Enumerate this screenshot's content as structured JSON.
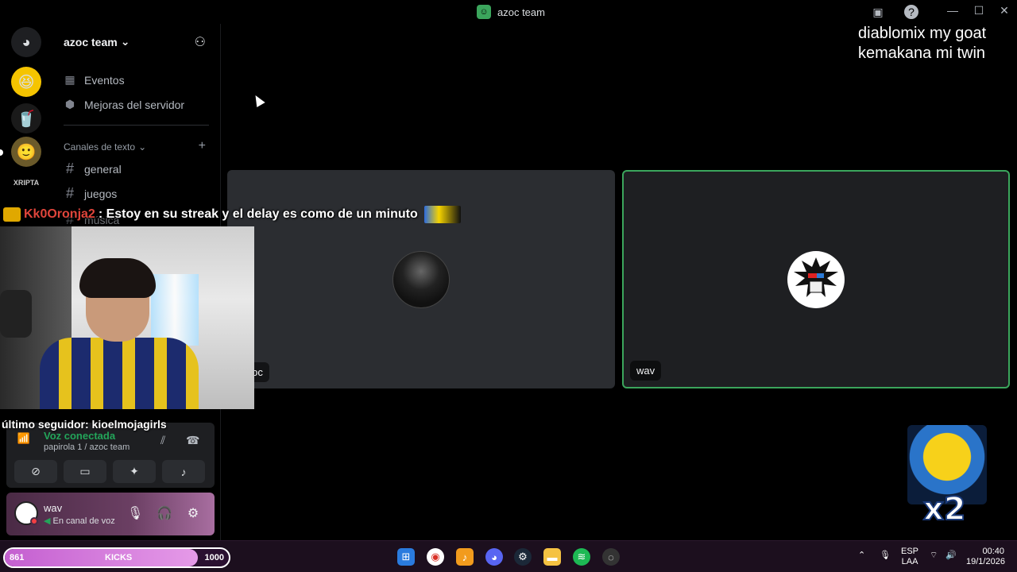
{
  "window": {
    "title": "azoc team"
  },
  "server": {
    "name": "azoc team",
    "menu": [
      {
        "label": "Eventos"
      },
      {
        "label": "Mejoras del servidor"
      }
    ],
    "category": "Canales de texto",
    "channels": [
      "general",
      "juegos",
      "música"
    ]
  },
  "voice": {
    "tiles": [
      {
        "name": "Azoc"
      },
      {
        "name": "wav"
      }
    ],
    "panel": {
      "status": "Voz conectada",
      "location": "papirola 1 / azoc team"
    }
  },
  "user": {
    "name": "wav",
    "status": "En canal de voz"
  },
  "stream_overlay": {
    "chat": {
      "user": "Kk0Oronja2",
      "message": ": Estoy en su streak y el delay es como de un minuto"
    },
    "follower": "último seguidor: kioelmojagirls",
    "top_right": [
      "diablomix my goat",
      "kemakana mi twin"
    ],
    "emote_label": "x2",
    "kicks": {
      "label": "KICKS",
      "current": "861",
      "goal": "1000",
      "progress": 0.861
    }
  },
  "taskbar": {
    "lang_top": "ESP",
    "lang_bottom": "LAA",
    "time": "00:40",
    "date": "19/1/2026"
  },
  "colors": {
    "accent_green": "#3ba55c",
    "speaking_border": "#3ba55c",
    "kicks_fill": "#c45fd0"
  }
}
